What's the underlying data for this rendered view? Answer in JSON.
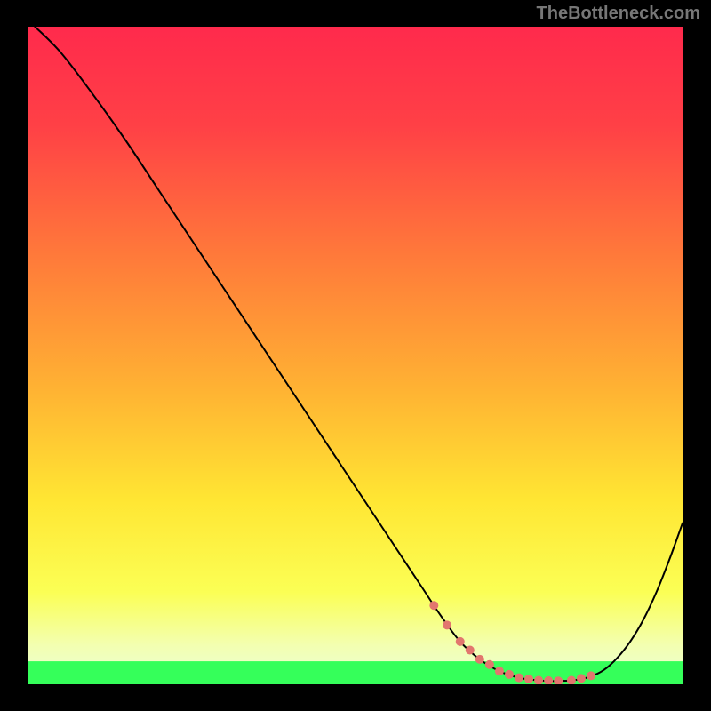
{
  "watermark": "TheBottleneck.com",
  "chart_data": {
    "type": "line",
    "title": "",
    "xlabel": "",
    "ylabel": "",
    "xlim": [
      0,
      100
    ],
    "ylim": [
      0,
      100
    ],
    "grid": false,
    "series": [
      {
        "name": "curve",
        "stroke": "#000000",
        "stroke_width": 2,
        "x": [
          1,
          5,
          10,
          15,
          20,
          25,
          30,
          35,
          40,
          45,
          50,
          55,
          60,
          63,
          66,
          69,
          72,
          75,
          78,
          81,
          84,
          86,
          88,
          90,
          92,
          94,
          96,
          98,
          100
        ],
        "y": [
          100,
          96,
          89.5,
          82.5,
          75,
          67.5,
          60,
          52.5,
          45,
          37.5,
          30,
          22.5,
          15,
          10.5,
          6.5,
          3.8,
          2.0,
          1.0,
          0.6,
          0.5,
          0.7,
          1.2,
          2.2,
          4.0,
          6.5,
          9.8,
          14.0,
          19.0,
          24.5
        ]
      },
      {
        "name": "green-band",
        "kind": "rect",
        "x0": 0,
        "x1": 100,
        "y0": 0.0,
        "y1": 3.5,
        "fill": "#35ff5a"
      },
      {
        "name": "highlight-dots",
        "kind": "dots",
        "stroke": "#e2766e",
        "r": 5,
        "x": [
          62,
          64,
          66,
          67.5,
          69,
          70.5,
          72,
          73.5,
          75,
          76.5,
          78,
          79.5,
          81,
          83,
          84.5,
          86
        ],
        "y": [
          12.0,
          9.0,
          6.5,
          5.2,
          3.8,
          3.0,
          2.0,
          1.5,
          1.0,
          0.8,
          0.6,
          0.55,
          0.5,
          0.6,
          0.9,
          1.3
        ]
      }
    ],
    "background_gradient": {
      "stops": [
        {
          "offset": 0.0,
          "color": "#ff2a4c"
        },
        {
          "offset": 0.15,
          "color": "#ff4046"
        },
        {
          "offset": 0.35,
          "color": "#ff7a3a"
        },
        {
          "offset": 0.55,
          "color": "#ffb233"
        },
        {
          "offset": 0.72,
          "color": "#ffe633"
        },
        {
          "offset": 0.86,
          "color": "#fbff55"
        },
        {
          "offset": 0.94,
          "color": "#f3ffb0"
        },
        {
          "offset": 1.0,
          "color": "#e9ffd8"
        }
      ]
    }
  }
}
